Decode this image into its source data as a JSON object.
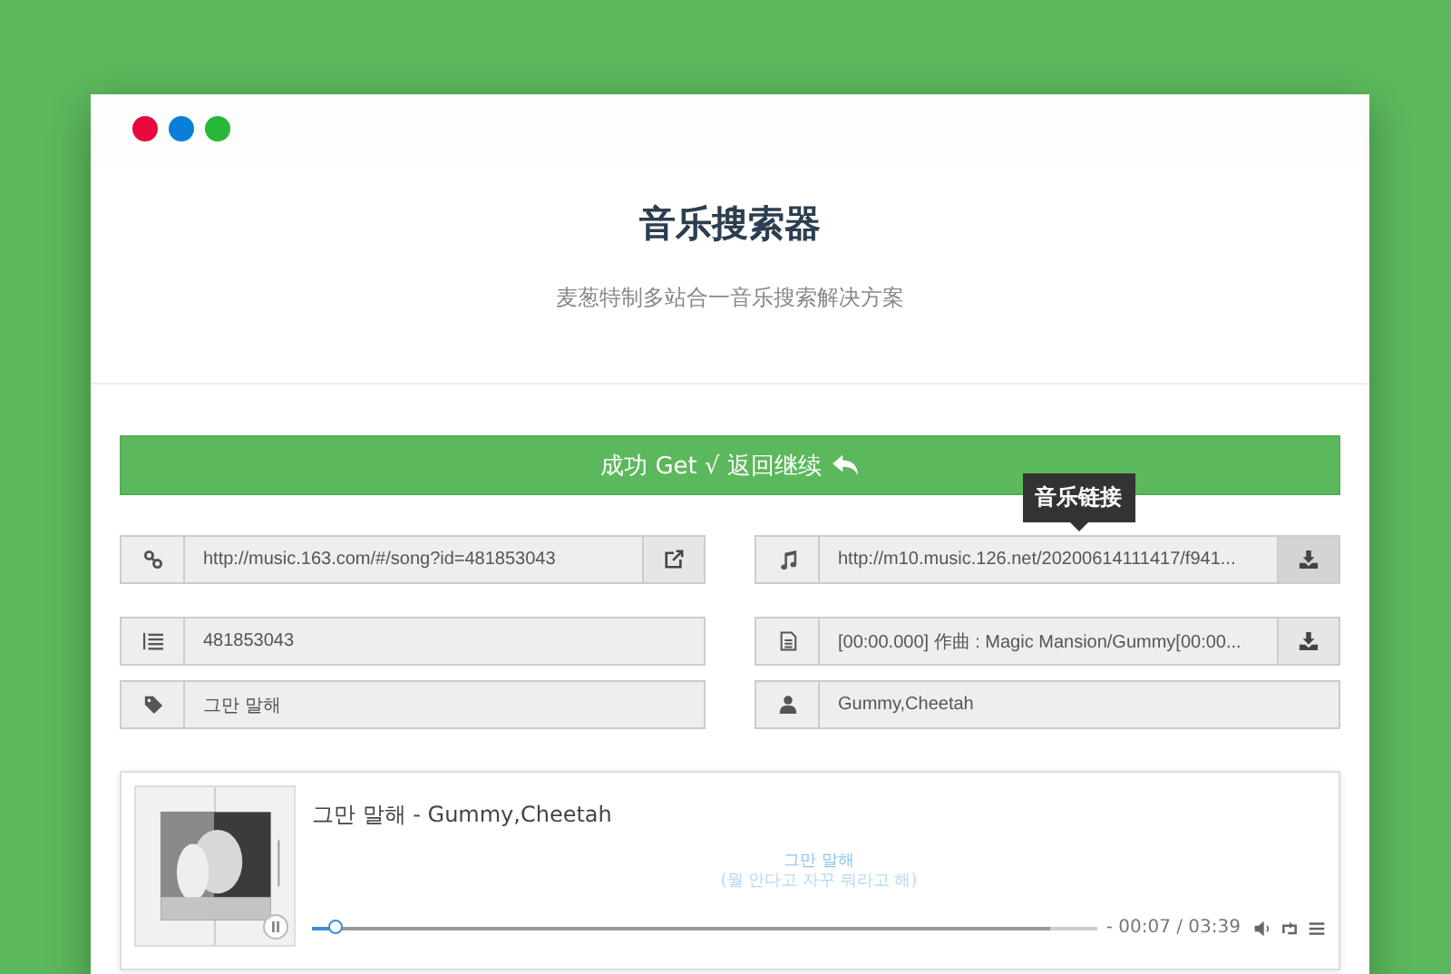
{
  "window": {
    "dots": [
      {
        "color": "#e8083e"
      },
      {
        "color": "#0a7fd8"
      },
      {
        "color": "#27b83a"
      }
    ]
  },
  "header": {
    "title": "音乐搜索器",
    "subtitle": "麦葱特制多站合一音乐搜索解决方案"
  },
  "banner_button": {
    "label": "成功 Get √ 返回继续"
  },
  "field_rows": [
    [
      {
        "kind": "url",
        "value": "http://music.163.com/#/song?id=481853043",
        "action": {
          "kind": "open",
          "pressed": false
        }
      },
      {
        "kind": "song_url",
        "value": "http://m10.music.126.net/20200614111417/f941...",
        "tooltip": "音乐链接",
        "action": {
          "kind": "download",
          "pressed": true
        }
      }
    ],
    [
      {
        "kind": "id",
        "value": "481853043"
      },
      {
        "kind": "lyric",
        "value": "[00:00.000] 作曲 : Magic Mansion/Gummy[00:00...",
        "action": {
          "kind": "download",
          "pressed": false
        }
      }
    ],
    [
      {
        "kind": "name",
        "value": "그만 말해"
      },
      {
        "kind": "artist",
        "value": "Gummy,Cheetah"
      }
    ]
  ],
  "player": {
    "cover": {
      "kind": "picture"
    },
    "title": "그만 말해 - Gummy,Cheetah",
    "lyrics": [
      "그만 말해",
      "(뭘 안다고 자꾸 뭐라고 해)"
    ],
    "progress": {
      "level": 0.03
    },
    "buffer": {
      "level": 0.94
    },
    "time": "- 00:07 / 03:39"
  }
}
